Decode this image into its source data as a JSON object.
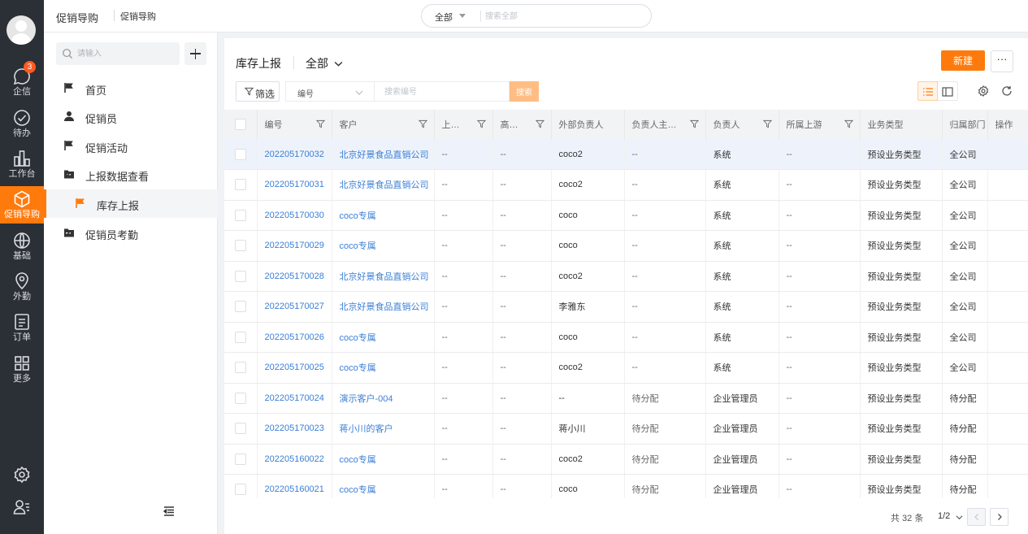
{
  "rail": {
    "items": [
      {
        "label": "企信",
        "badge": "3"
      },
      {
        "label": "待办"
      },
      {
        "label": "工作台"
      },
      {
        "label": "促销导购"
      },
      {
        "label": "基础"
      },
      {
        "label": "外勤"
      },
      {
        "label": "订单"
      },
      {
        "label": "更多"
      }
    ]
  },
  "topbar": {
    "breadcrumb_app": "促销导购",
    "breadcrumb_page": "促销导购",
    "search_scope": "全部",
    "search_placeholder": "搜索全部"
  },
  "sidenav": {
    "search_placeholder": "请输入",
    "items": [
      {
        "label": "首页"
      },
      {
        "label": "促销员"
      },
      {
        "label": "促销活动"
      },
      {
        "label": "上报数据查看"
      },
      {
        "label": "库存上报"
      },
      {
        "label": "促销员考勤"
      }
    ]
  },
  "main": {
    "title": "库存上报",
    "view": "全部",
    "new_label": "新建",
    "more_label": "···",
    "filter_label": "筛选",
    "field_label": "编号",
    "field_placeholder": "搜索编号",
    "search_label": "搜索"
  },
  "table": {
    "columns": [
      "编号",
      "客户",
      "上…",
      "高…",
      "外部负责人",
      "负责人主…",
      "负责人",
      "所属上游",
      "业务类型",
      "归属部门",
      "操作"
    ],
    "rows": [
      [
        "202205170032",
        "北京好景食品直销公司",
        "--",
        "--",
        "coco2",
        "--",
        "系统",
        "--",
        "预设业务类型",
        "全公司"
      ],
      [
        "202205170031",
        "北京好景食品直销公司",
        "--",
        "--",
        "coco2",
        "--",
        "系统",
        "--",
        "预设业务类型",
        "全公司"
      ],
      [
        "202205170030",
        "coco专属",
        "--",
        "--",
        "coco",
        "--",
        "系统",
        "--",
        "预设业务类型",
        "全公司"
      ],
      [
        "202205170029",
        "coco专属",
        "--",
        "--",
        "coco",
        "--",
        "系统",
        "--",
        "预设业务类型",
        "全公司"
      ],
      [
        "202205170028",
        "北京好景食品直销公司",
        "--",
        "--",
        "coco2",
        "--",
        "系统",
        "--",
        "预设业务类型",
        "全公司"
      ],
      [
        "202205170027",
        "北京好景食品直销公司",
        "--",
        "--",
        "李雅东",
        "--",
        "系统",
        "--",
        "预设业务类型",
        "全公司"
      ],
      [
        "202205170026",
        "coco专属",
        "--",
        "--",
        "coco",
        "--",
        "系统",
        "--",
        "预设业务类型",
        "全公司"
      ],
      [
        "202205170025",
        "coco专属",
        "--",
        "--",
        "coco2",
        "--",
        "系统",
        "--",
        "预设业务类型",
        "全公司"
      ],
      [
        "202205170024",
        "演示客户-004",
        "--",
        "--",
        "--",
        "待分配",
        "企业管理员",
        "--",
        "预设业务类型",
        "待分配"
      ],
      [
        "202205170023",
        "蒋小川的客户",
        "--",
        "--",
        "蒋小川",
        "待分配",
        "企业管理员",
        "--",
        "预设业务类型",
        "待分配"
      ],
      [
        "202205160022",
        "coco专属",
        "--",
        "--",
        "coco2",
        "待分配",
        "企业管理员",
        "--",
        "预设业务类型",
        "待分配"
      ],
      [
        "202205160021",
        "coco专属",
        "--",
        "--",
        "coco",
        "待分配",
        "企业管理员",
        "--",
        "预设业务类型",
        "待分配"
      ]
    ]
  },
  "pager": {
    "total": "共 32 条",
    "page": "1/2"
  },
  "colors": {
    "accent": "#ff7a0d",
    "rail_bg": "#2b2f36",
    "link": "#3b7fd6"
  }
}
